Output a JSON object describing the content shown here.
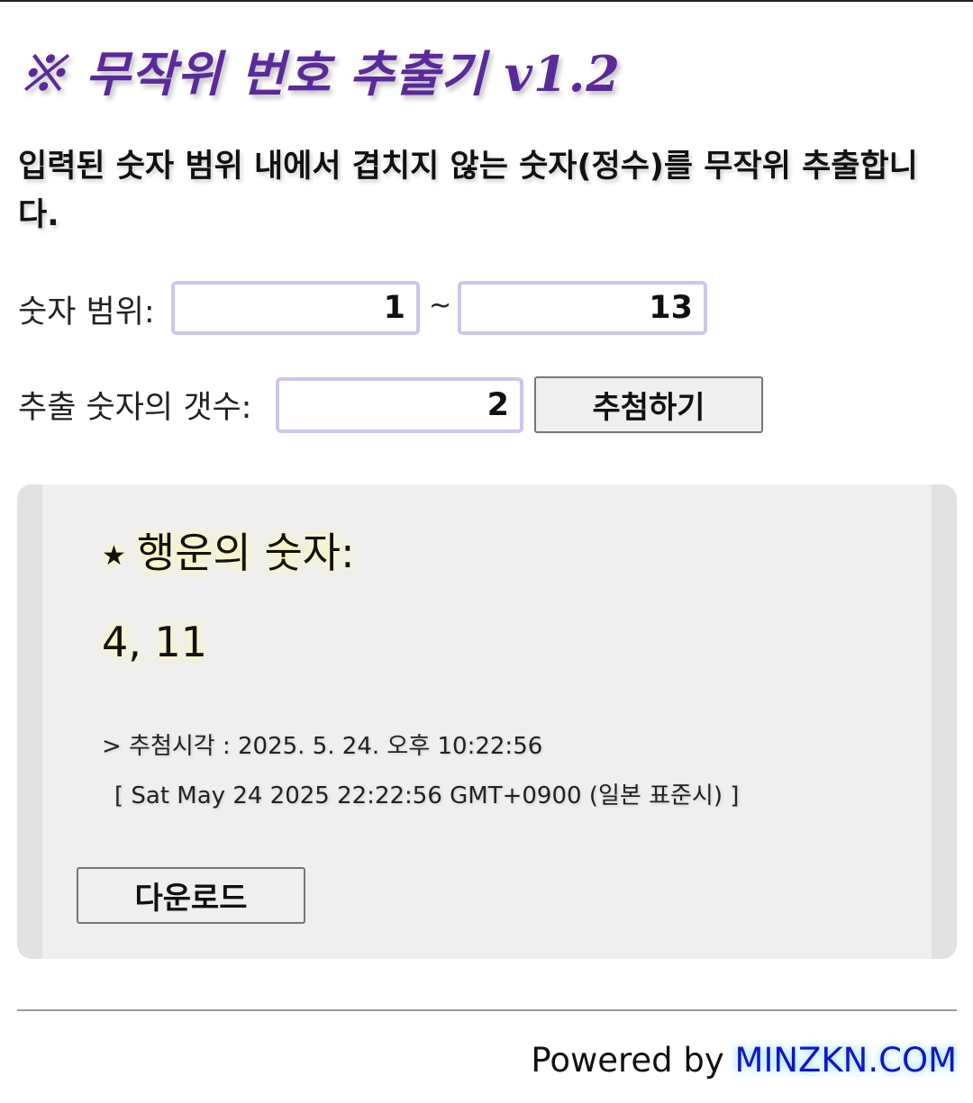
{
  "header": {
    "title": "※ 무작위 번호 추출기 v1.2",
    "description": "입력된 숫자 범위 내에서 겹치지 않는 숫자(정수)를 무작위 추출합니다."
  },
  "range": {
    "label": "숫자 범위:",
    "min_value": "1",
    "separator": "~",
    "max_value": "13"
  },
  "count": {
    "label": "추출 숫자의 갯수:",
    "value": "2",
    "draw_button": "추첨하기"
  },
  "result": {
    "star": "★",
    "heading": "행운의 숫자:",
    "numbers": "4, 11",
    "draw_time": "> 추첨시각 : 2025. 5. 24. 오후 10:22:56",
    "draw_time_full": "[ Sat May 24 2025 22:22:56 GMT+0900 (일본 표준시) ]",
    "download_button": "다운로드"
  },
  "footer": {
    "powered_by": "Powered by ",
    "site": "MINZKN.COM"
  },
  "colors": {
    "title": "#5b2a9a",
    "input_border": "#c9c8f0",
    "link": "#1414c8"
  }
}
